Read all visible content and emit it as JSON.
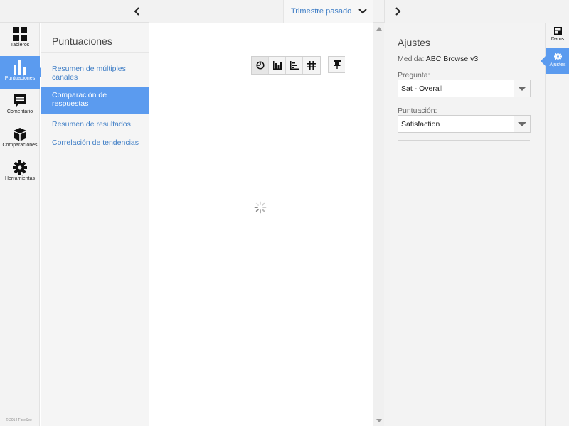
{
  "topbar": {
    "date_filter_label": "Trimestre pasado"
  },
  "rail": {
    "items": [
      {
        "label": "Tableros",
        "icon": "dashboard-icon",
        "active": false
      },
      {
        "label": "Puntuaciones",
        "icon": "bar-chart-icon",
        "active": true
      },
      {
        "label": "Comentario",
        "icon": "comment-icon",
        "active": false
      },
      {
        "label": "Comparaciones",
        "icon": "cube-icon",
        "active": false
      },
      {
        "label": "Herramientas",
        "icon": "gear-icon",
        "active": false
      }
    ],
    "copyright": "© 2014 ForeSee"
  },
  "nav": {
    "title": "Puntuaciones",
    "items": [
      {
        "label": "Resumen de múltiples canales",
        "active": false
      },
      {
        "label": "Comparación de respuestas",
        "active": true
      },
      {
        "label": "Resumen de resultados",
        "active": false
      },
      {
        "label": "Correlación de tendencias",
        "active": false
      }
    ]
  },
  "toolbar": {
    "buttons": [
      "pie-chart-icon",
      "column-chart-icon",
      "horizontal-bar-icon",
      "grid-icon"
    ],
    "extra": "pin-icon"
  },
  "settings": {
    "title": "Ajustes",
    "measure_key": "Medida:",
    "measure_value": "ABC Browse v3",
    "question_label": "Pregunta:",
    "question_value": "Sat - Overall",
    "score_label": "Puntuación:",
    "score_value": "Satisfaction"
  },
  "right_rail": {
    "items": [
      {
        "label": "Datos",
        "icon": "data-icon",
        "active": false
      },
      {
        "label": "Ajustes",
        "icon": "gear-icon",
        "active": true
      }
    ]
  },
  "colors": {
    "accent": "#5b9bef",
    "link": "#3f7ec6"
  }
}
